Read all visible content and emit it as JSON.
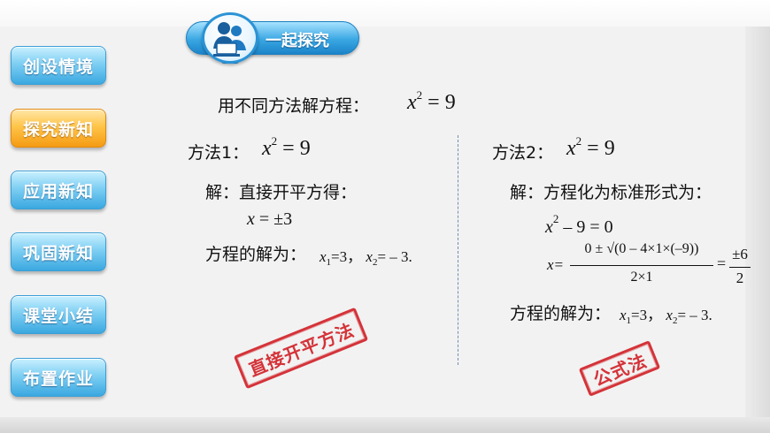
{
  "sidebar": {
    "items": [
      {
        "label": "创设情境",
        "active": false
      },
      {
        "label": "探究新知",
        "active": true
      },
      {
        "label": "应用新知",
        "active": false
      },
      {
        "label": "巩固新知",
        "active": false
      },
      {
        "label": "课堂小结",
        "active": false
      },
      {
        "label": "布置作业",
        "active": false
      }
    ]
  },
  "header": {
    "title": "一起探究",
    "icon": "people-computer-icon"
  },
  "problem": {
    "prefix": "用不同方法解方程：",
    "var": "x",
    "exp": "2",
    "rhs": "= 9"
  },
  "method1": {
    "label": "方法1：",
    "eq_var": "x",
    "eq_exp": "2",
    "eq_rhs": "= 9",
    "step_label": "解：直接开平方得：",
    "step_var": "x",
    "step_rhs": " = ±3",
    "solution_label": "方程的解为：",
    "x1_sub": "1",
    "x1_val": "=3，",
    "x2_sub": "2",
    "x2_val": "= – 3."
  },
  "method2": {
    "label": "方法2：",
    "eq_var": "x",
    "eq_exp": "2",
    "eq_rhs": "= 9",
    "step_label": "解：方程化为标准形式为：",
    "std_var": "x",
    "std_exp": "2",
    "std_rhs": "– 9 = 0",
    "formula_lhs": "x=",
    "numerator": "0 ± √(0 – 4×1×(–9))",
    "denominator": "2×1",
    "equals": "=",
    "result_num": "±6",
    "result_den": "2",
    "solution_label": "方程的解为：",
    "x1_sub": "1",
    "x1_val": "=3，",
    "x2_sub": "2",
    "x2_val": "= – 3."
  },
  "stamps": {
    "method1": "直接开平方法",
    "method2": "公式法"
  },
  "colors": {
    "nav_blue": "#3aa8e0",
    "nav_orange": "#f49b12",
    "stamp_red": "#d2232a",
    "divider": "#6f8fb3"
  }
}
